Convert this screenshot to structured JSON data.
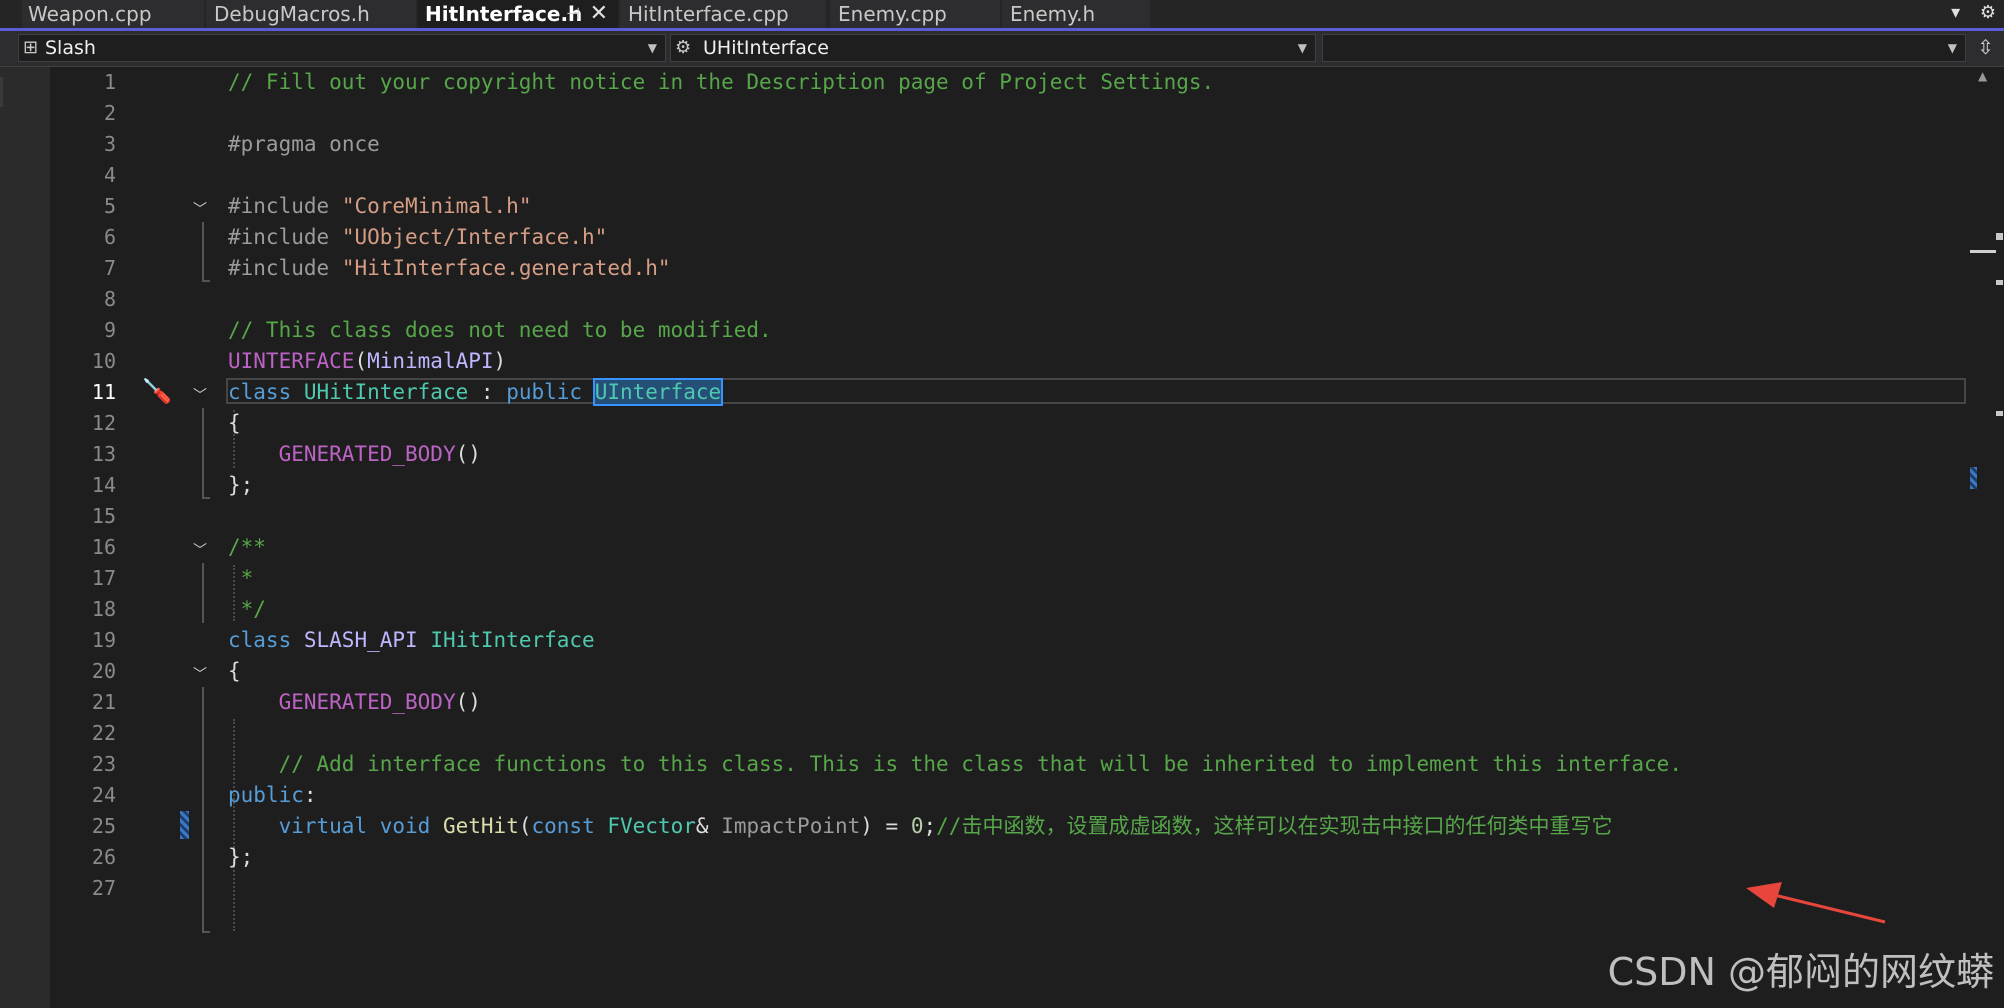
{
  "tabs": [
    {
      "label": "Weapon.cpp",
      "active": false
    },
    {
      "label": "DebugMacros.h",
      "active": false
    },
    {
      "label": "HitInterface.h",
      "active": true
    },
    {
      "label": "HitInterface.cpp",
      "active": false
    },
    {
      "label": "Enemy.cpp",
      "active": false
    },
    {
      "label": "Enemy.h",
      "active": false
    }
  ],
  "nav": {
    "project": "Slash",
    "scope": "UHitInterface",
    "member": ""
  },
  "current_line": 11,
  "lines": [
    {
      "n": "1",
      "text": "// Fill out your copyright notice in the Description page of Project Settings."
    },
    {
      "n": "2",
      "text": ""
    },
    {
      "n": "3",
      "text": "#pragma once"
    },
    {
      "n": "4",
      "text": ""
    },
    {
      "n": "5",
      "text": "#include \"CoreMinimal.h\""
    },
    {
      "n": "6",
      "text": "#include \"UObject/Interface.h\""
    },
    {
      "n": "7",
      "text": "#include \"HitInterface.generated.h\""
    },
    {
      "n": "8",
      "text": ""
    },
    {
      "n": "9",
      "text": "// This class does not need to be modified."
    },
    {
      "n": "10",
      "text": "UINTERFACE(MinimalAPI)"
    },
    {
      "n": "11",
      "text": "class UHitInterface : public UInterface"
    },
    {
      "n": "12",
      "text": "{"
    },
    {
      "n": "13",
      "text": "    GENERATED_BODY()"
    },
    {
      "n": "14",
      "text": "};"
    },
    {
      "n": "15",
      "text": ""
    },
    {
      "n": "16",
      "text": "/**"
    },
    {
      "n": "17",
      "text": " *"
    },
    {
      "n": "18",
      "text": " */"
    },
    {
      "n": "19",
      "text": "class SLASH_API IHitInterface"
    },
    {
      "n": "20",
      "text": "{"
    },
    {
      "n": "21",
      "text": "    GENERATED_BODY()"
    },
    {
      "n": "22",
      "text": ""
    },
    {
      "n": "23",
      "text": "    // Add interface functions to this class. This is the class that will be inherited to implement this interface."
    },
    {
      "n": "24",
      "text": "public:"
    },
    {
      "n": "25",
      "text": "    virtual void GetHit(const FVector& ImpactPoint) = 0;//击中函数，设置成虚函数，这样可以在实现击中接口的任何类中重写它"
    },
    {
      "n": "26",
      "text": "};"
    },
    {
      "n": "27",
      "text": ""
    }
  ],
  "watermark": "CSDN @郁闷的网纹蟒",
  "colors": {
    "background": "#1e1e1e",
    "comment": "#57a64a",
    "keyword": "#569cd6",
    "type": "#4ec9b0",
    "string": "#d69d85",
    "macro": "#bd63c5",
    "function": "#dcdcaa",
    "accent": "#5c5cd6",
    "annotation_arrow": "#e8453c"
  },
  "icons": {
    "tab_pin": "pin-icon",
    "tab_close": "close-icon",
    "overflow": "chevron-down-icon",
    "settings": "gear-icon",
    "project": "project-icon",
    "scope": "class-icon",
    "split": "split-editor-icon",
    "quick_action": "screwdriver-icon"
  }
}
